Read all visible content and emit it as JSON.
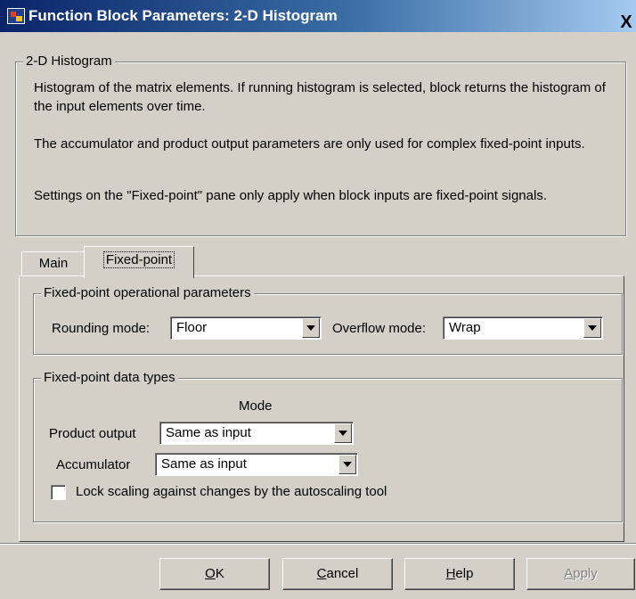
{
  "window": {
    "title": "Function Block Parameters: 2-D Histogram",
    "close_glyph": "X"
  },
  "description": {
    "group_title": "2-D Histogram",
    "paragraphs": [
      "Histogram of the matrix elements.  If running histogram is selected, block returns the histogram of the input elements over time.",
      "The accumulator and product output parameters are only used for complex fixed-point inputs.",
      "Settings on the \"Fixed-point\" pane only apply when block inputs are fixed-point signals."
    ]
  },
  "tabs": [
    {
      "label": "Main",
      "active": false
    },
    {
      "label": "Fixed-point",
      "active": true
    }
  ],
  "operational": {
    "group_title": "Fixed-point operational parameters",
    "rounding_label": "Rounding mode:",
    "rounding_value": "Floor",
    "overflow_label": "Overflow mode:",
    "overflow_value": "Wrap"
  },
  "datatypes": {
    "group_title": "Fixed-point data types",
    "mode_header": "Mode",
    "product_output_label": "Product output",
    "product_output_value": "Same as input",
    "accumulator_label": "Accumulator",
    "accumulator_value": "Same as input",
    "lock_scaling_label": "Lock scaling against changes by the autoscaling tool",
    "lock_scaling_checked": false
  },
  "buttons": {
    "ok": {
      "mnemonic": "O",
      "rest": "K"
    },
    "cancel": {
      "mnemonic": "C",
      "rest": "ancel"
    },
    "help": {
      "mnemonic": "H",
      "rest": "elp"
    },
    "apply": {
      "mnemonic": "A",
      "rest": "pply",
      "enabled": false
    }
  },
  "colors": {
    "dialog_bg": "#d4d0c8",
    "titlebar_start": "#0a246a",
    "titlebar_end": "#a6caf0"
  }
}
